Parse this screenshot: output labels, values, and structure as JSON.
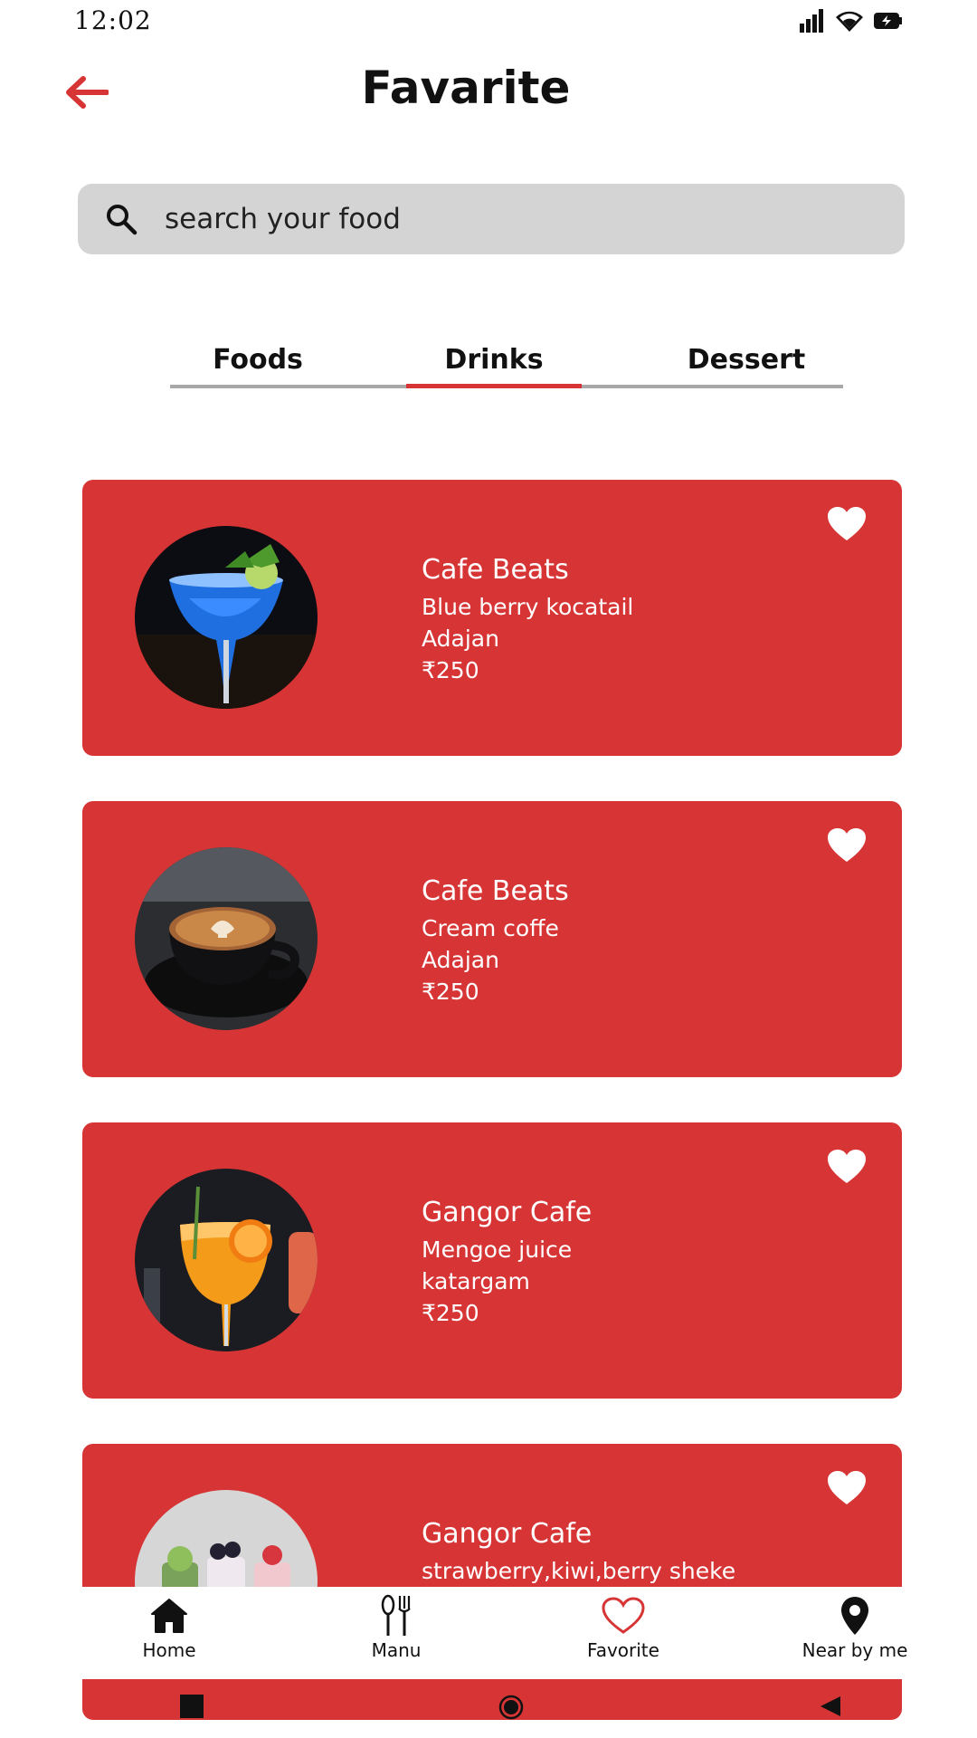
{
  "status": {
    "time": "12:02"
  },
  "header": {
    "title": "Favarite"
  },
  "search": {
    "placeholder": "search your food"
  },
  "tabs": [
    {
      "label": "Foods"
    },
    {
      "label": "Drinks",
      "active": true
    },
    {
      "label": "Dessert"
    }
  ],
  "cards": [
    {
      "cafe": "Cafe Beats",
      "item": "Blue berry kocatail",
      "area": "Adajan",
      "price": "₹250",
      "image": "blue-cocktail"
    },
    {
      "cafe": "Cafe Beats",
      "item": "Cream coffe",
      "area": "Adajan",
      "price": "₹250",
      "image": "latte-cup"
    },
    {
      "cafe": "Gangor Cafe",
      "item": "Mengoe juice",
      "area": "katargam",
      "price": "₹250",
      "image": "orange-drink"
    },
    {
      "cafe": "Gangor Cafe",
      "item": "strawberry,kiwi,berry sheke",
      "image": "shakes"
    }
  ],
  "bottom_nav": [
    {
      "label": "Home",
      "icon": "home-icon"
    },
    {
      "label": "Manu",
      "icon": "cutlery-icon"
    },
    {
      "label": "Favorite",
      "icon": "heart-outline-icon",
      "active": true
    },
    {
      "label": "Near by me",
      "icon": "location-pin-icon"
    }
  ],
  "colors": {
    "accent": "#d73535",
    "search_bg": "#d4d4d4"
  }
}
